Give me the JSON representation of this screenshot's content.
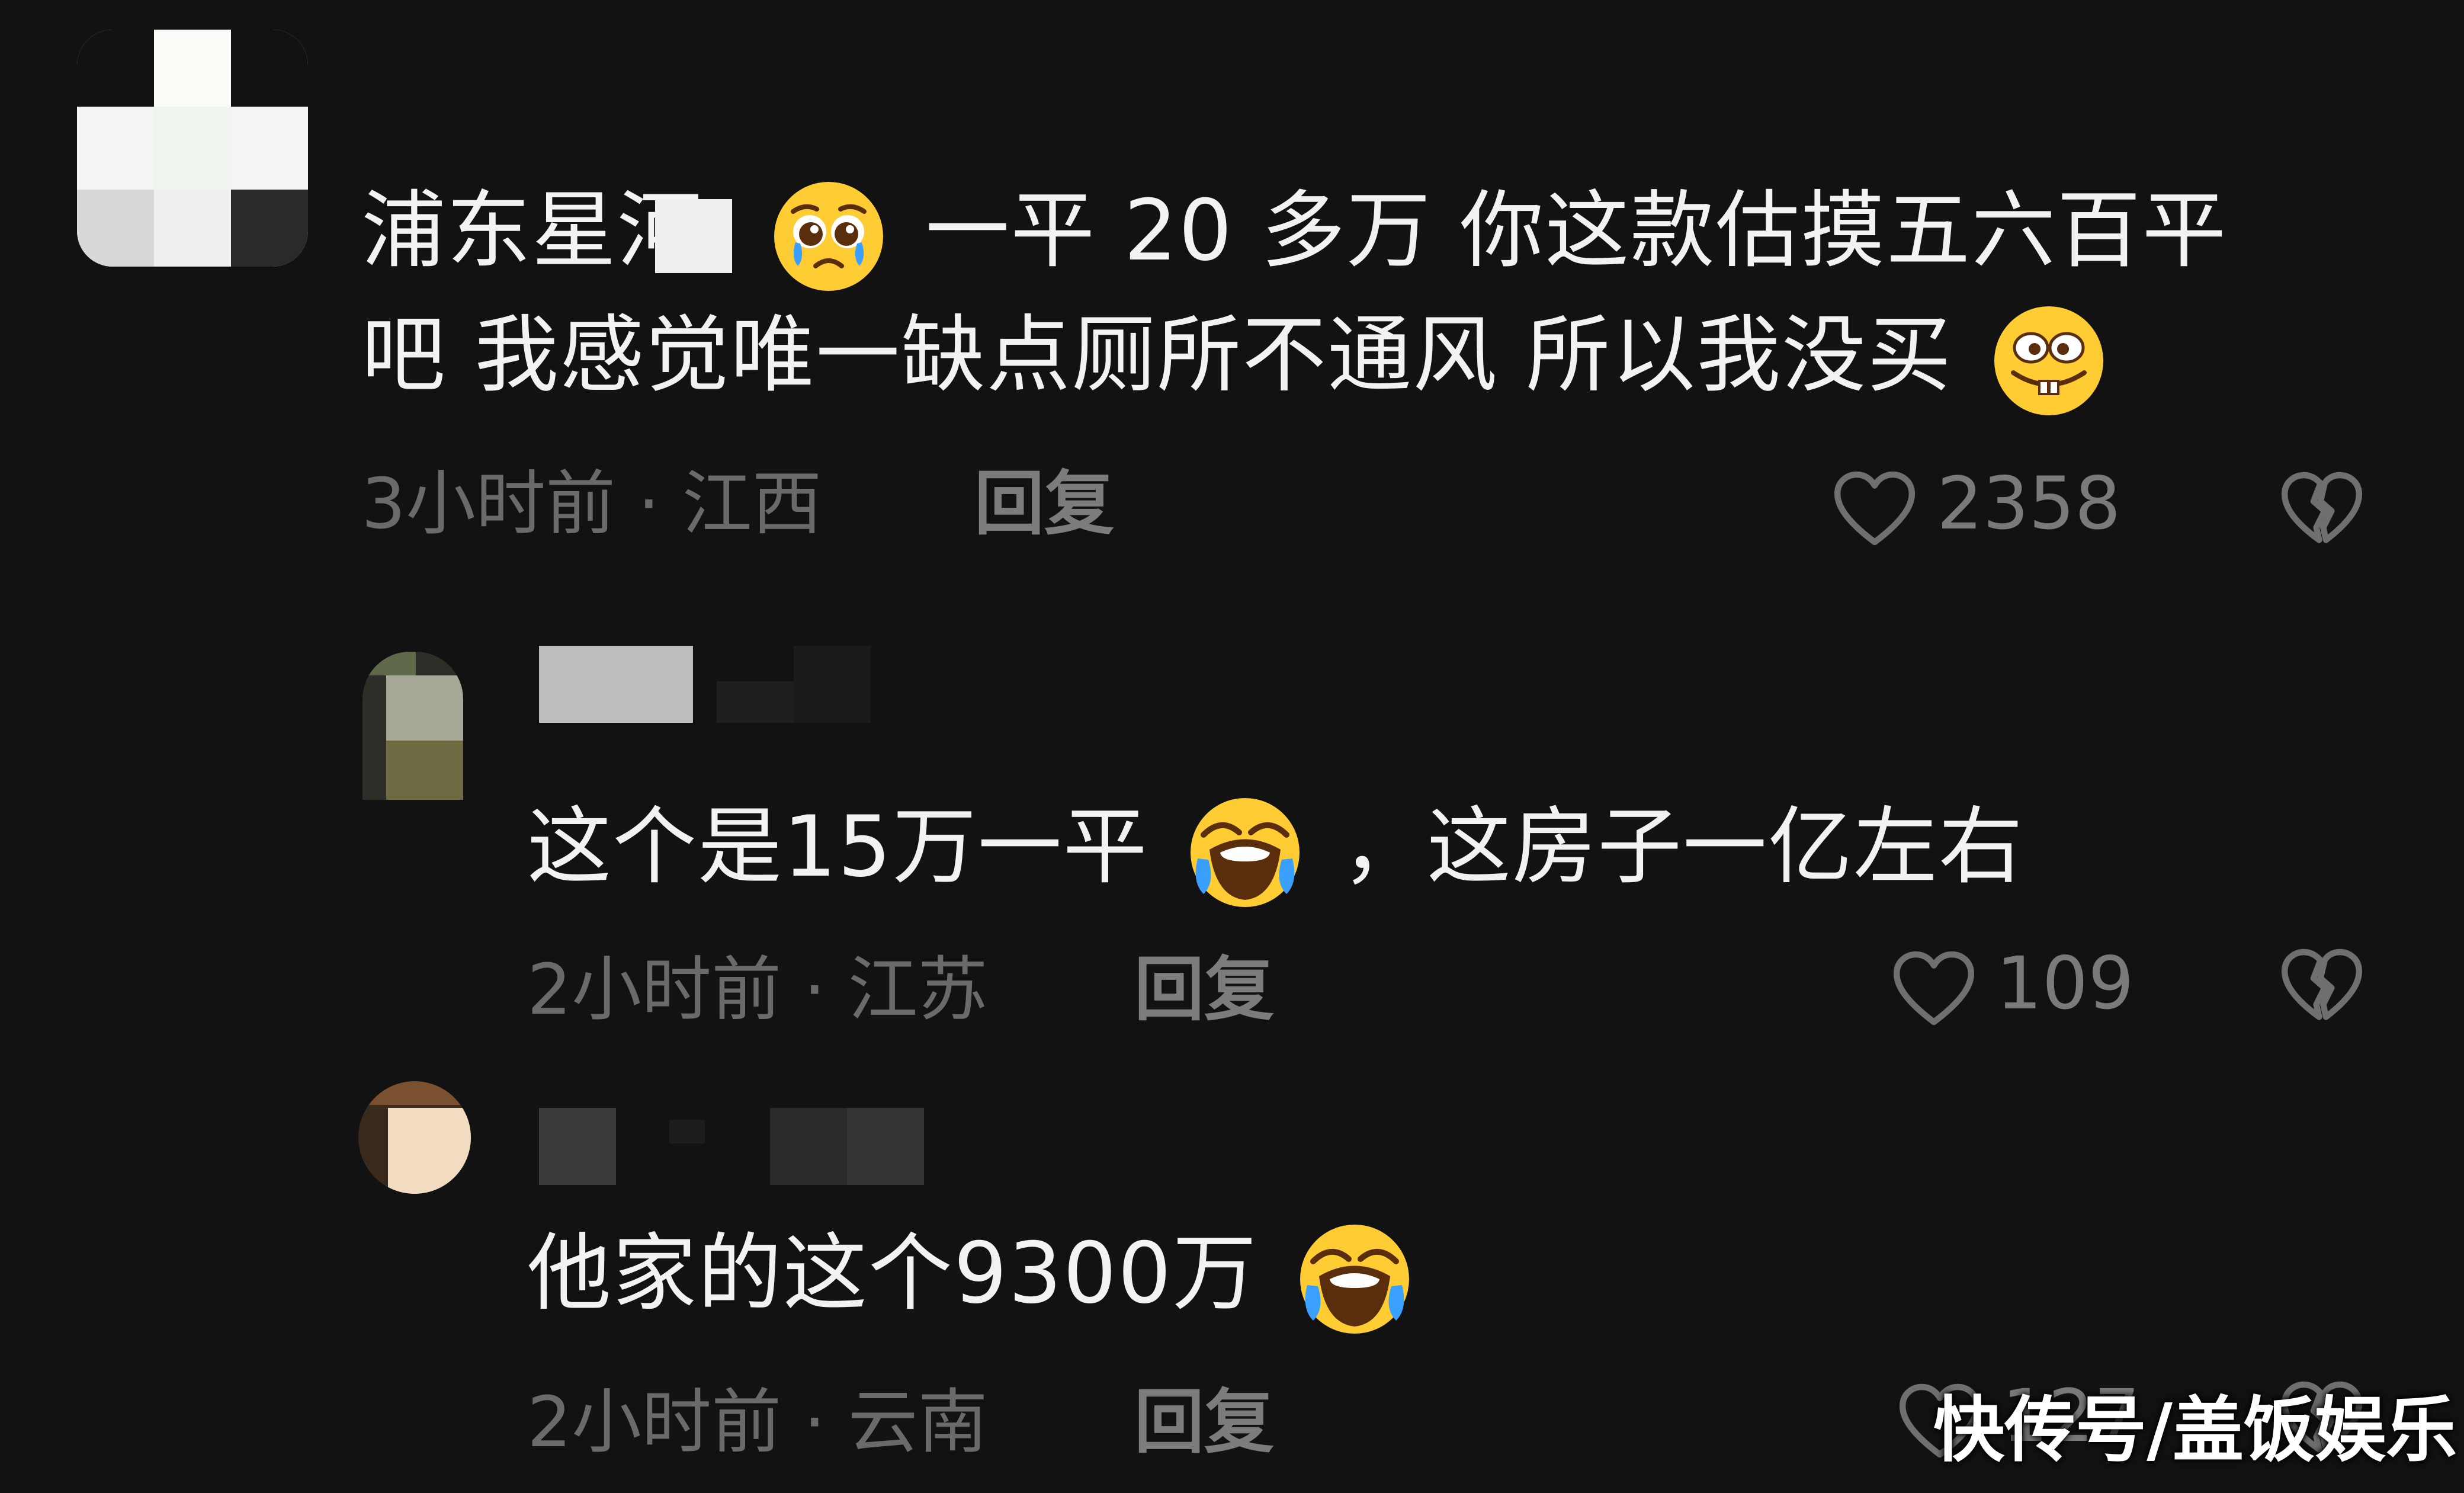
{
  "comments": [
    {
      "text_part1": "浦东星河",
      "text_part2": "一平 20 多万 你这款估摸五六百平",
      "text_line2": "吧  我感觉唯一缺点厕所不通风  所以我没买",
      "time_location": "3小时前 · 江西",
      "reply_label": "回复",
      "like_count": "2358"
    },
    {
      "text_part1": "这个是15万一平",
      "text_part2": "，这房子一亿左右",
      "time_location": "2小时前 · 江苏",
      "reply_label": "回复",
      "like_count": "109"
    },
    {
      "text_part1": "他家的这个9300万",
      "time_location": "2小时前 · 云南",
      "reply_label": "回复",
      "like_count": "127"
    }
  ],
  "watermark": "快传号/盖饭娱乐",
  "icons": {
    "like": "heart-outline-icon",
    "dislike": "broken-heart-icon",
    "emoji_crying": "pleading-crying-emoji-icon",
    "emoji_grin": "buck-teeth-grin-emoji-icon",
    "emoji_laugh": "rolling-laughing-tears-emoji-icon"
  },
  "colors": {
    "background": "#121212",
    "text_primary": "#f2f2f2",
    "text_secondary": "#6a6a6a"
  }
}
